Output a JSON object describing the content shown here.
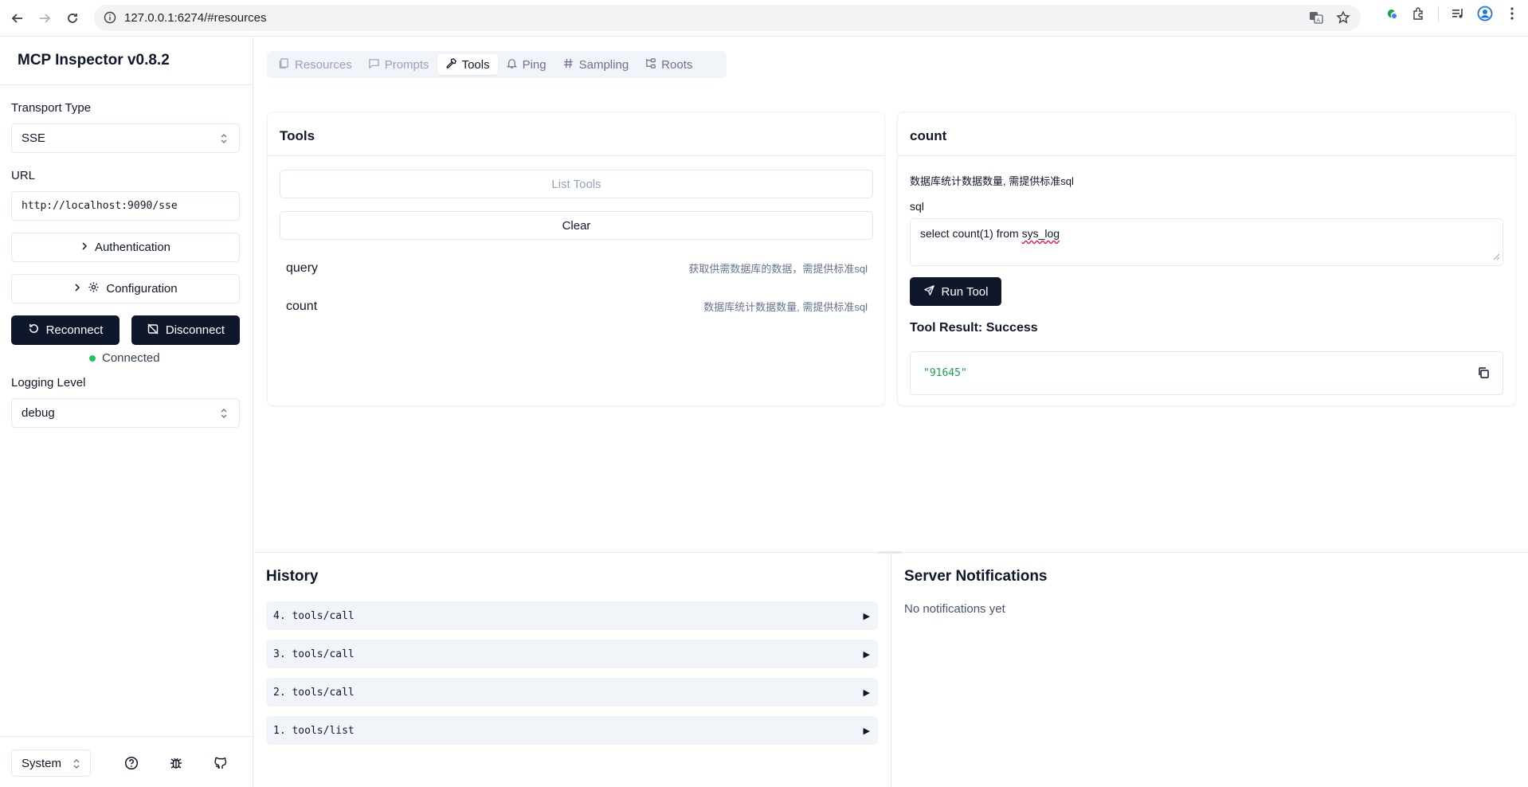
{
  "browser": {
    "url": "127.0.0.1:6274/#resources"
  },
  "sidebar": {
    "title": "MCP Inspector v0.8.2",
    "transport_label": "Transport Type",
    "transport_value": "SSE",
    "url_label": "URL",
    "url_value": "http://localhost:9090/sse",
    "auth_label": "Authentication",
    "config_label": "Configuration",
    "reconnect_label": "Reconnect",
    "disconnect_label": "Disconnect",
    "status_text": "Connected",
    "logging_label": "Logging Level",
    "logging_value": "debug",
    "theme_value": "System"
  },
  "tabs": [
    {
      "label": "Resources",
      "state": "disabled"
    },
    {
      "label": "Prompts",
      "state": "disabled"
    },
    {
      "label": "Tools",
      "state": "active"
    },
    {
      "label": "Ping",
      "state": "normal"
    },
    {
      "label": "Sampling",
      "state": "normal"
    },
    {
      "label": "Roots",
      "state": "normal"
    }
  ],
  "tools_panel": {
    "title": "Tools",
    "list_button": "List Tools",
    "clear_button": "Clear",
    "items": [
      {
        "name": "query",
        "description": "获取供需数据库的数据，需提供标准sql"
      },
      {
        "name": "count",
        "description": "数据库统计数据数量, 需提供标准sql"
      }
    ]
  },
  "detail_panel": {
    "title": "count",
    "description": "数据库统计数据数量, 需提供标准sql",
    "param_label": "sql",
    "param_value_prefix": "select count(1) from ",
    "param_value_flagged": "sys_log",
    "run_button": "Run Tool",
    "result_title": "Tool Result: Success",
    "result_value": "\"91645\""
  },
  "history": {
    "title": "History",
    "items": [
      {
        "label": "4. tools/call"
      },
      {
        "label": "3. tools/call"
      },
      {
        "label": "2. tools/call"
      },
      {
        "label": "1. tools/list"
      }
    ]
  },
  "notifications": {
    "title": "Server Notifications",
    "empty_text": "No notifications yet"
  },
  "colors": {
    "primary": "#0f172a",
    "success": "#16a34a",
    "status_dot": "#22c55e",
    "muted": "#64748b"
  }
}
